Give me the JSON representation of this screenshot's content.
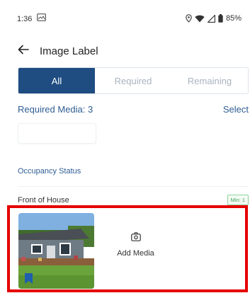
{
  "status_bar": {
    "time": "1:36",
    "message_icon": "image-message-icon",
    "battery": "85%"
  },
  "header": {
    "title": "Image Label",
    "back_icon": "arrow-left-icon"
  },
  "tabs": [
    {
      "label": "All",
      "active": true
    },
    {
      "label": "Required",
      "active": false
    },
    {
      "label": "Remaining",
      "active": false
    }
  ],
  "required_media": {
    "label": "Required Media: 3",
    "action": "Select"
  },
  "section": {
    "title": "Occupancy Status"
  },
  "field": {
    "label": "Front of House",
    "badge": "Min: 1"
  },
  "media": {
    "add_label": "Add Media",
    "add_icon": "camera-icon"
  },
  "colors": {
    "primary": "#1f4d82",
    "link": "#2f5d93",
    "badge_green": "#3fa456",
    "highlight_red": "#e60000"
  }
}
